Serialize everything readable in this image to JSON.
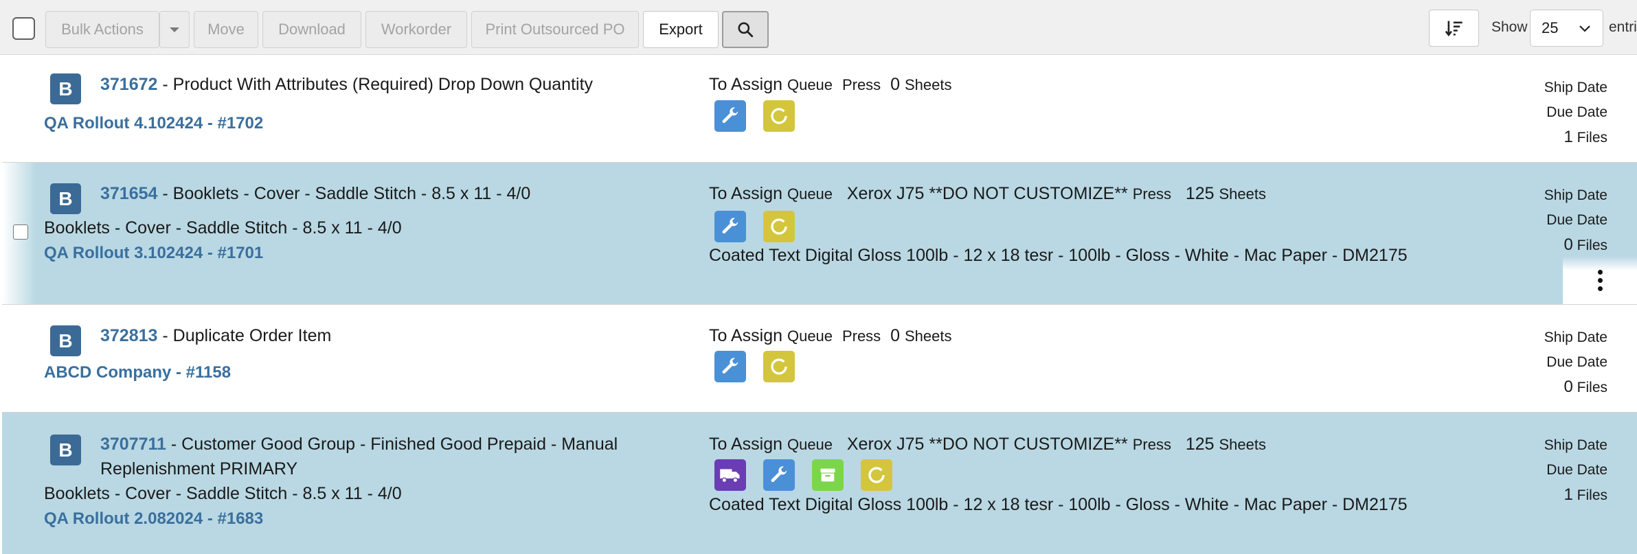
{
  "toolbar": {
    "bulk_actions": "Bulk Actions",
    "move": "Move",
    "download": "Download",
    "workorder": "Workorder",
    "print_outsourced_po": "Print Outsourced PO",
    "export": "Export",
    "show_label": "Show",
    "entries_per_page": "25",
    "entries_label": "entries"
  },
  "labels": {
    "to_assign": "To Assign",
    "queue": "Queue",
    "press": "Press",
    "sheets": "Sheets",
    "ship_date": "Ship Date",
    "due_date": "Due Date",
    "files": "Files",
    "badge": "B"
  },
  "rows": [
    {
      "id": "371672",
      "title": " - Product With Attributes (Required) Drop Down Quantity",
      "order": "QA Rollout 4.102424 - #1702",
      "press_name": "",
      "sheets_count": "0",
      "files_count": "1",
      "icons": [
        "wrench-icon",
        "status-icon"
      ]
    },
    {
      "id": "371654",
      "title": " - Booklets - Cover - Saddle Stitch - 8.5 x 11 - 4/0",
      "description": "Booklets - Cover - Saddle Stitch - 8.5 x 11 - 4/0",
      "order": "QA Rollout 3.102424 - #1701",
      "press_name": "Xerox J75 **DO NOT CUSTOMIZE**",
      "sheets_count": "125",
      "paper": "Coated Text Digital Gloss 100lb - 12 x 18 tesr - 100lb - Gloss - White - Mac Paper - DM2175",
      "files_count": "0",
      "icons": [
        "wrench-icon",
        "status-icon"
      ]
    },
    {
      "id": "372813",
      "title": " - Duplicate Order Item",
      "order": "ABCD Company - #1158",
      "press_name": "",
      "sheets_count": "0",
      "files_count": "0",
      "icons": [
        "wrench-icon",
        "status-icon"
      ]
    },
    {
      "id": "3707711",
      "title": " - Customer Good Group - Finished Good Prepaid - Manual",
      "title_cont": "Replenishment PRIMARY",
      "description": "Booklets - Cover - Saddle Stitch - 8.5 x 11 - 4/0",
      "order": "QA Rollout 2.082024 - #1683",
      "press_name": "Xerox J75 **DO NOT CUSTOMIZE**",
      "sheets_count": "125",
      "paper": "Coated Text Digital Gloss 100lb - 12 x 18 tesr - 100lb - Gloss - White - Mac Paper - DM2175",
      "files_count": "1",
      "icons": [
        "truck-icon",
        "wrench-icon",
        "box-icon",
        "status-icon"
      ]
    }
  ],
  "colors": {
    "link_blue": "#3a6f9e",
    "badge_blue": "#3c6a96",
    "row_highlight": "#b9d8e3",
    "wrench_tile": "#4a90d6",
    "status_tile": "#d4c63c",
    "truck_tile": "#6b3db4",
    "box_tile": "#7bd64a"
  }
}
